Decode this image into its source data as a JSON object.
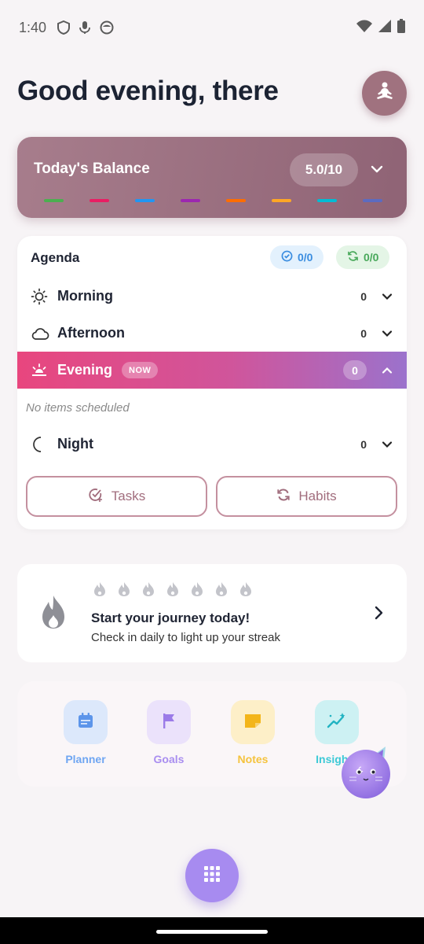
{
  "status_bar": {
    "time": "1:40"
  },
  "header": {
    "greeting": "Good evening, there"
  },
  "balance": {
    "title": "Today's Balance",
    "score": "5.0/10",
    "dash_colors": [
      "#4caf50",
      "#e91e63",
      "#2196f3",
      "#9c27b0",
      "#ff6d00",
      "#ffa726",
      "#00bcd4",
      "#5c6bc0"
    ]
  },
  "agenda": {
    "title": "Agenda",
    "tasks_count": "0/0",
    "habits_count": "0/0",
    "periods": [
      {
        "label": "Morning",
        "count": "0"
      },
      {
        "label": "Afternoon",
        "count": "0"
      },
      {
        "label": "Evening",
        "count": "0",
        "badge": "NOW"
      },
      {
        "label": "Night",
        "count": "0"
      }
    ],
    "empty_text": "No items scheduled",
    "tasks_button": "Tasks",
    "habits_button": "Habits"
  },
  "streak": {
    "title": "Start your journey today!",
    "subtitle": "Check in daily to light up your streak"
  },
  "quick_actions": [
    {
      "label": "Planner",
      "color": "#6fa6f2"
    },
    {
      "label": "Goals",
      "color": "#a98ef0"
    },
    {
      "label": "Notes",
      "color": "#f5c33d"
    },
    {
      "label": "Insights",
      "color": "#3cc9d6"
    }
  ],
  "colors": {
    "accent": "#a0727f",
    "evening_gradient": [
      "#e8467e",
      "#9b72cc"
    ],
    "fab": "#a78bf0"
  }
}
